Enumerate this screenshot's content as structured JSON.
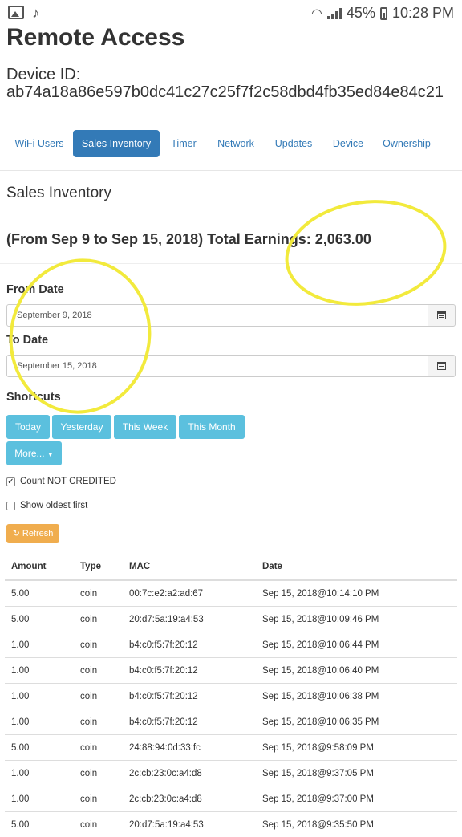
{
  "status_bar": {
    "battery": "45%",
    "time": "10:28 PM",
    "icons": [
      "image-icon",
      "music-note-icon",
      "wifi-icon",
      "signal-icon",
      "battery-icon"
    ]
  },
  "page": {
    "title": "Remote Access",
    "device_label": "Device ID:",
    "device_id": "ab74a18a86e597b0dc41c27c25f7f2c58dbd4fb35ed84e84c21"
  },
  "tabs": [
    "WiFi Users",
    "Sales Inventory",
    "Timer",
    "Network",
    "Updates",
    "Device",
    "Ownership"
  ],
  "active_tab": "Sales Inventory",
  "section_title": "Sales Inventory",
  "earnings_text": "(From Sep 9 to Sep 15, 2018) Total Earnings: 2,063.00",
  "from_date": {
    "label": "From Date",
    "value": "September 9, 2018"
  },
  "to_date": {
    "label": "To Date",
    "value": "September 15, 2018"
  },
  "shortcuts": {
    "label": "Shortcuts",
    "buttons": [
      "Today",
      "Yesterday",
      "This Week",
      "This Month"
    ],
    "more": "More..."
  },
  "options": {
    "count_not_credited": {
      "label": "Count NOT CREDITED",
      "checked": true
    },
    "show_oldest_first": {
      "label": "Show oldest first",
      "checked": false
    }
  },
  "refresh_label": "Refresh",
  "table": {
    "headers": [
      "Amount",
      "Type",
      "MAC",
      "Date"
    ],
    "rows": [
      [
        "5.00",
        "coin",
        "00:7c:e2:a2:ad:67",
        "Sep 15, 2018@10:14:10 PM"
      ],
      [
        "5.00",
        "coin",
        "20:d7:5a:19:a4:53",
        "Sep 15, 2018@10:09:46 PM"
      ],
      [
        "1.00",
        "coin",
        "b4:c0:f5:7f:20:12",
        "Sep 15, 2018@10:06:44 PM"
      ],
      [
        "1.00",
        "coin",
        "b4:c0:f5:7f:20:12",
        "Sep 15, 2018@10:06:40 PM"
      ],
      [
        "1.00",
        "coin",
        "b4:c0:f5:7f:20:12",
        "Sep 15, 2018@10:06:38 PM"
      ],
      [
        "1.00",
        "coin",
        "b4:c0:f5:7f:20:12",
        "Sep 15, 2018@10:06:35 PM"
      ],
      [
        "5.00",
        "coin",
        "24:88:94:0d:33:fc",
        "Sep 15, 2018@9:58:09 PM"
      ],
      [
        "1.00",
        "coin",
        "2c:cb:23:0c:a4:d8",
        "Sep 15, 2018@9:37:05 PM"
      ],
      [
        "1.00",
        "coin",
        "2c:cb:23:0c:a4:d8",
        "Sep 15, 2018@9:37:00 PM"
      ],
      [
        "5.00",
        "coin",
        "20:d7:5a:19:a4:53",
        "Sep 15, 2018@9:35:50 PM"
      ]
    ]
  },
  "colors": {
    "primary": "#337ab7",
    "info": "#5bc0de",
    "warning": "#f0ad4e",
    "highlight": "#f2ea3c"
  }
}
